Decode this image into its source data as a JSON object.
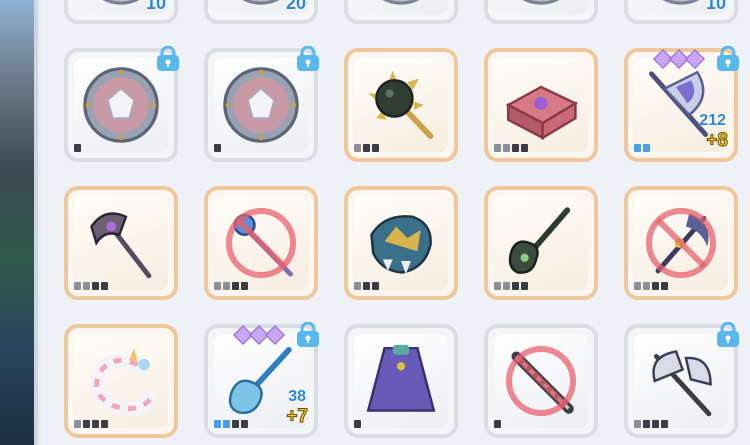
{
  "row0": [
    {
      "count": "10"
    },
    {
      "count": "20"
    },
    {
      "count": ""
    },
    {
      "count": ""
    },
    {
      "count": "10"
    }
  ],
  "row1": [
    {
      "name": "shield",
      "frame": "gray",
      "locked": true
    },
    {
      "name": "shield",
      "frame": "gray",
      "locked": true
    },
    {
      "name": "spiked-mace",
      "frame": "orange"
    },
    {
      "name": "treasure-chest",
      "frame": "orange"
    },
    {
      "name": "battle-axe",
      "frame": "orange",
      "locked": true,
      "count": "212",
      "plus": "+8"
    }
  ],
  "row2": [
    {
      "name": "dark-axe",
      "frame": "orange"
    },
    {
      "name": "staff",
      "frame": "orange",
      "banned": true
    },
    {
      "name": "dragon-gauntlet",
      "frame": "orange"
    },
    {
      "name": "guitar-blade",
      "frame": "orange"
    },
    {
      "name": "crescent-staff",
      "frame": "orange",
      "banned": true
    }
  ],
  "row3": [
    {
      "name": "unicorn-ring",
      "frame": "orange"
    },
    {
      "name": "ice-guitar",
      "frame": "gray",
      "locked": true,
      "count": "38",
      "plus": "+7"
    },
    {
      "name": "purple-cape",
      "frame": "gray"
    },
    {
      "name": "chain-blade",
      "frame": "gray",
      "banned": true
    },
    {
      "name": "double-axe",
      "frame": "gray",
      "locked": true
    }
  ]
}
